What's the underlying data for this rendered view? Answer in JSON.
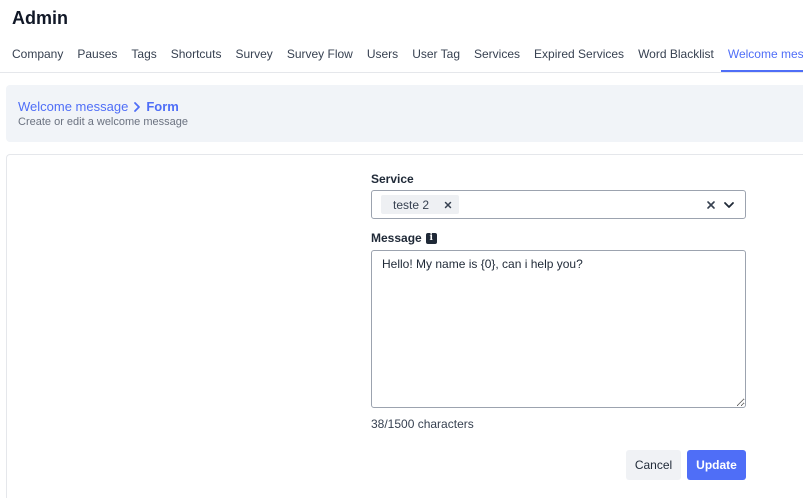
{
  "header": {
    "title": "Admin"
  },
  "tabs": [
    {
      "label": "Company"
    },
    {
      "label": "Pauses"
    },
    {
      "label": "Tags"
    },
    {
      "label": "Shortcuts"
    },
    {
      "label": "Survey"
    },
    {
      "label": "Survey Flow"
    },
    {
      "label": "Users"
    },
    {
      "label": "User Tag"
    },
    {
      "label": "Services"
    },
    {
      "label": "Expired Services"
    },
    {
      "label": "Word Blacklist"
    },
    {
      "label": "Welcome message",
      "active": true
    }
  ],
  "breadcrumb": {
    "parent": "Welcome message",
    "current": "Form",
    "subtitle": "Create or edit a welcome message"
  },
  "form": {
    "service_label": "Service",
    "service_selected": "teste 2",
    "message_label": "Message",
    "message_value": "Hello! My name is {0}, can i help you?",
    "char_count": "38/1500 characters",
    "cancel_label": "Cancel",
    "update_label": "Update"
  },
  "icons": {
    "breadcrumb_separator": "chevron-right-icon",
    "chip_remove": "close-icon",
    "clear_select": "close-icon",
    "dropdown": "chevron-down-icon",
    "message_info": "info-icon"
  },
  "colors": {
    "accent": "#4f6ef7",
    "panel_bg": "#f1f4f8",
    "chip_bg": "#eef0f3",
    "cancel_bg": "#f0f2f5"
  }
}
